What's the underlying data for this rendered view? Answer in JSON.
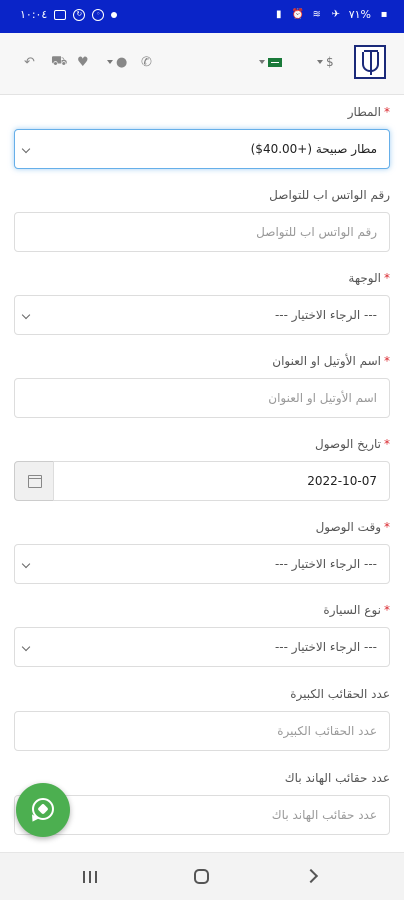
{
  "status_bar": {
    "time": "١٠:٠٤",
    "battery": "٧١%"
  },
  "header": {
    "currency": "$"
  },
  "form": {
    "airport": {
      "label": "المطار",
      "required": true,
      "value": "مطار صبيحة (+40.00$)"
    },
    "whatsapp": {
      "label": "رقم الواتس اب للتواصل",
      "required": false,
      "placeholder": "رقم الواتس اب للتواصل"
    },
    "destination": {
      "label": "الوجهة",
      "required": true,
      "value": "--- الرجاء الاختيار ---"
    },
    "hotel": {
      "label": "اسم الأوتيل او العنوان",
      "required": true,
      "placeholder": "اسم الأوتيل او العنوان"
    },
    "arrival_date": {
      "label": "تاريخ الوصول",
      "required": true,
      "value": "2022-10-07"
    },
    "arrival_time": {
      "label": "وقت الوصول",
      "required": true,
      "value": "--- الرجاء الاختيار ---"
    },
    "car_type": {
      "label": "نوع السيارة",
      "required": true,
      "value": "--- الرجاء الاختيار ---"
    },
    "large_bags": {
      "label": "عدد الحقائب الكبيرة",
      "required": false,
      "placeholder": "عدد الحقائب الكبيرة"
    },
    "hand_bags": {
      "label": "عدد حقائب الهاند باك",
      "required": false,
      "placeholder": "عدد حقائب الهاند باك"
    }
  },
  "icons": {
    "header": [
      "logo",
      "currency-caret",
      "flag-icon",
      "phone-icon",
      "user-icon",
      "heart-icon",
      "cart-icon",
      "share-icon"
    ],
    "fab": "whatsapp-icon",
    "nav": [
      "recents-icon",
      "home-icon",
      "back-icon"
    ]
  },
  "colors": {
    "status_bar": "#0a24c8",
    "required": "#d9272e",
    "focus": "#66afe9",
    "whatsapp": "#4caf50"
  }
}
